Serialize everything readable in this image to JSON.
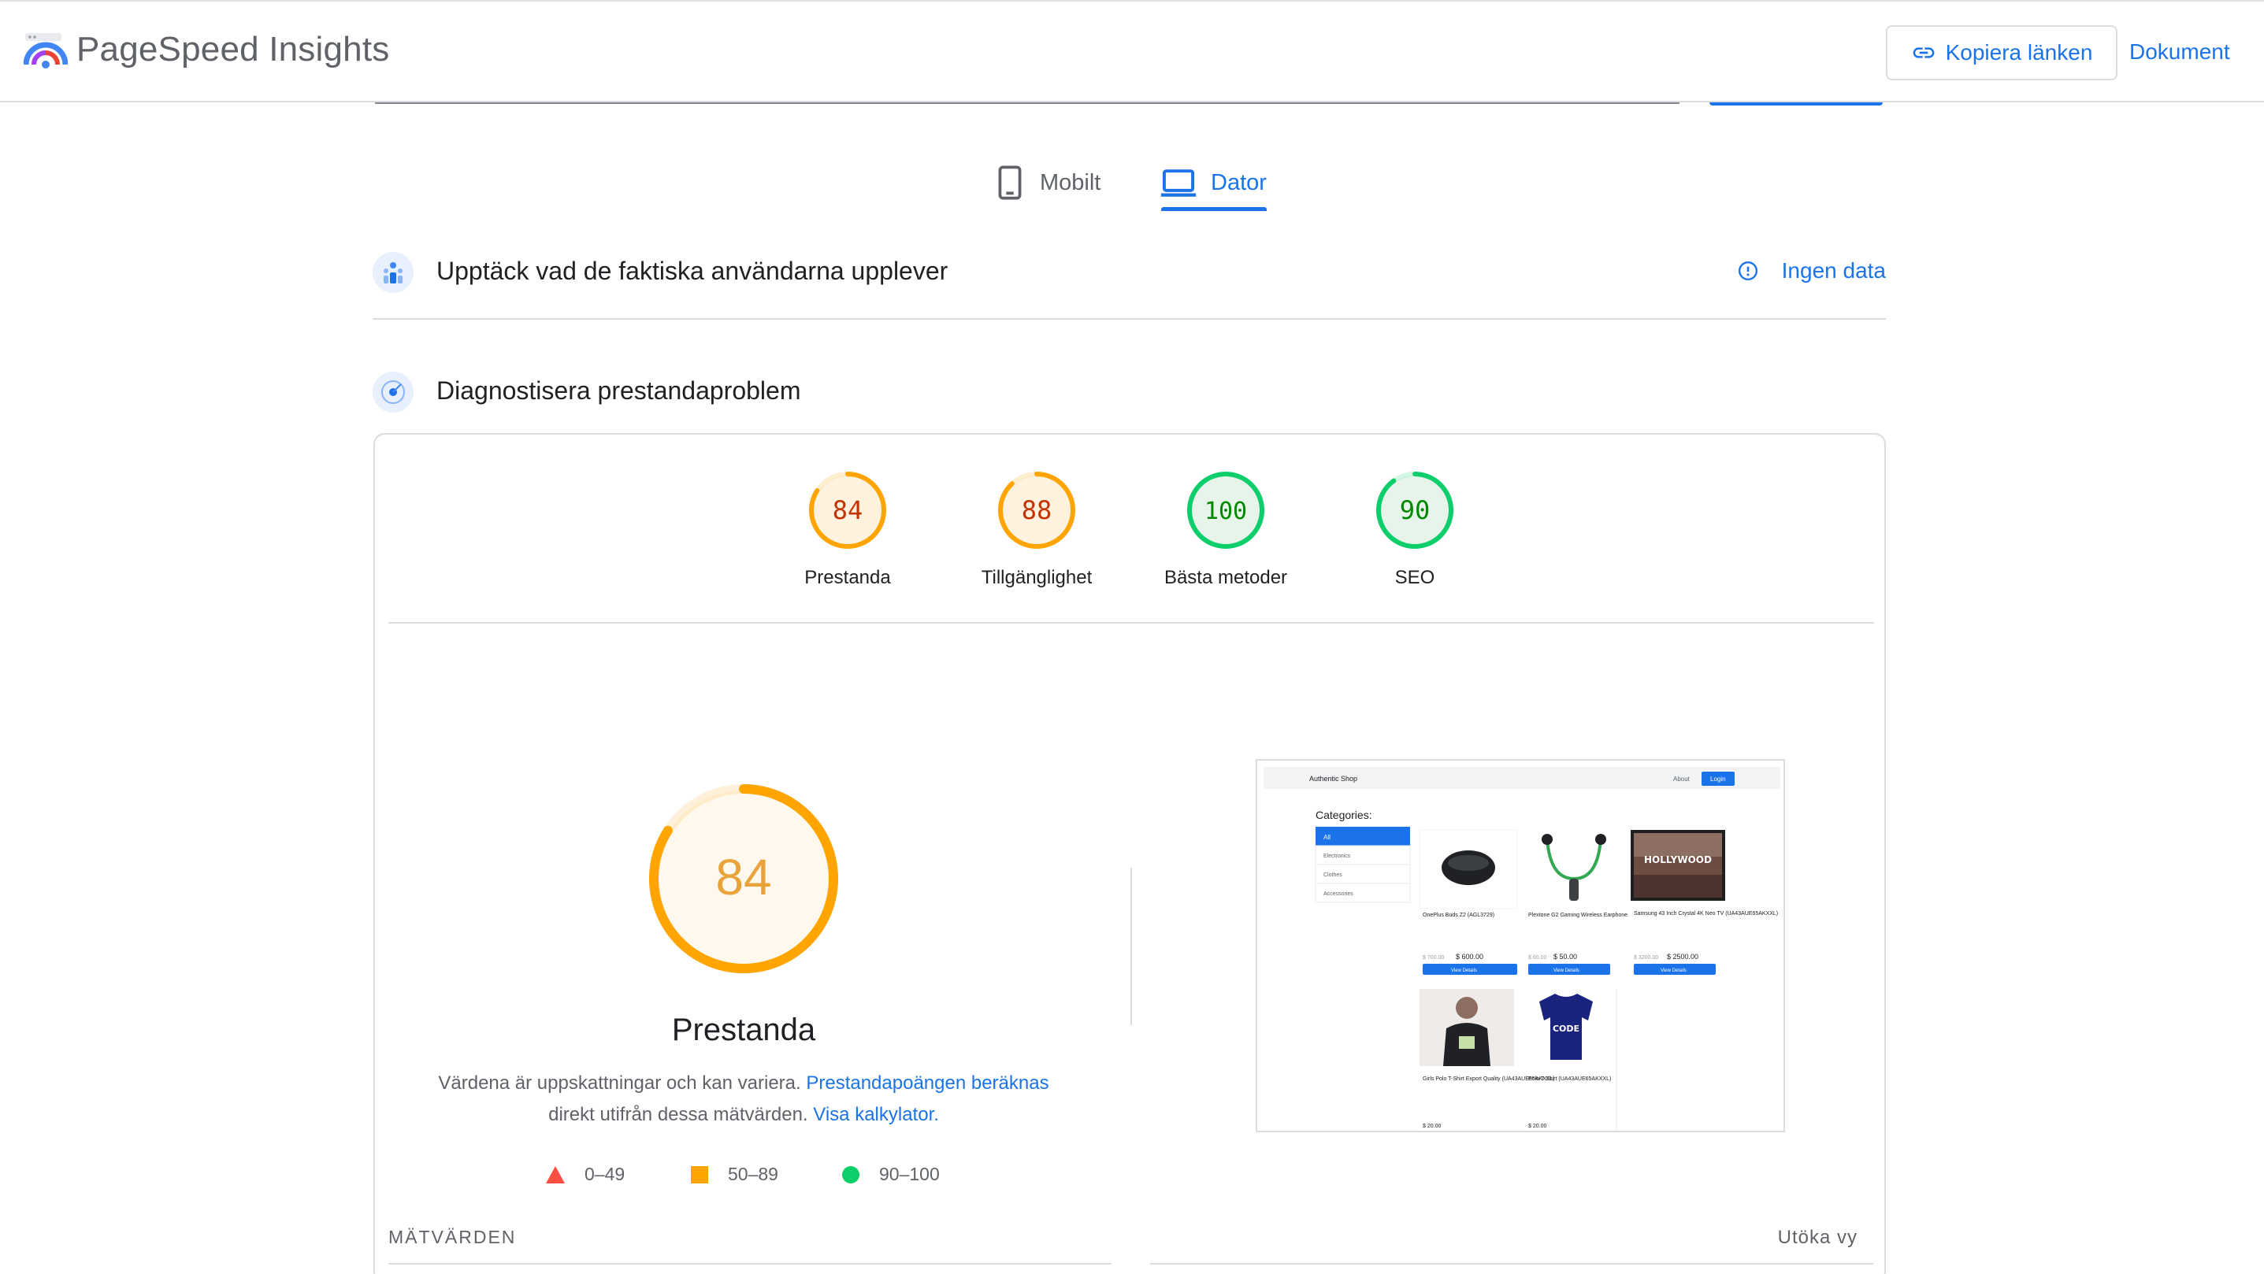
{
  "header": {
    "app_title": "PageSpeed Insights",
    "copy_link_label": "Kopiera länken",
    "docs_label": "Dokument"
  },
  "tabs": [
    {
      "label": "Mobilt",
      "icon": "smartphone-icon",
      "selected": false
    },
    {
      "label": "Dator",
      "icon": "laptop-icon",
      "selected": true
    }
  ],
  "crux": {
    "title": "Upptäck vad de faktiska användarna upplever",
    "status_label": "Ingen data"
  },
  "diagnose": {
    "title": "Diagnostisera prestandaproblem"
  },
  "scores": [
    {
      "label": "Prestanda",
      "value": "84",
      "rating": "average"
    },
    {
      "label": "Tillgänglighet",
      "value": "88",
      "rating": "average"
    },
    {
      "label": "Bästa metoder",
      "value": "100",
      "rating": "pass"
    },
    {
      "label": "SEO",
      "value": "90",
      "rating": "pass"
    }
  ],
  "performance": {
    "score": "84",
    "title": "Prestanda",
    "desc_text_1": "Värdena är uppskattningar och kan variera.",
    "desc_link_1": "Prestandapoängen beräknas",
    "desc_text_2": "direkt utifrån dessa mätvärden.",
    "desc_link_2": "Visa kalkylator."
  },
  "legend": [
    {
      "label": "0–49",
      "shape": "triangle",
      "color": "#ff4e42"
    },
    {
      "label": "50–89",
      "shape": "square",
      "color": "#ffa400"
    },
    {
      "label": "90–100",
      "shape": "circle",
      "color": "#0cce6b"
    }
  ],
  "metrics": {
    "label": "MÄTVÄRDEN",
    "expand_label": "Utöka vy"
  },
  "screenshot": {
    "brand": "Authentic Shop",
    "about": "About",
    "login": "Login",
    "categories_title": "Categories:",
    "categories": [
      "All",
      "Electronics",
      "Clothes",
      "Accessories"
    ],
    "products": [
      {
        "name": "OnePlus Buds Z2 (AGL3729)",
        "old_price": "$ 700.00",
        "price": "$ 600.00",
        "button": "View Details"
      },
      {
        "name": "Plextone G2 Gaming Wireless Earphone",
        "old_price": "$ 60.00",
        "price": "$ 50.00",
        "button": "View Details"
      },
      {
        "name": "Samsung 43 Inch Crystal 4K Neo TV (UA43AUE65AKXXL)",
        "old_price": "$ 3200.00",
        "price": "$ 2500.00",
        "button": "View Details"
      },
      {
        "name": "Girls Polo T-Shirt Export Quality (UA43AUE65AKXXL)",
        "old_price": "",
        "price": "$ 20.00",
        "button": ""
      },
      {
        "name": "Polo T-Shirt (UA43AUE65AKXXL)",
        "old_price": "",
        "price": "$ 20.00",
        "button": ""
      }
    ],
    "tv_text": "HOLLYWOOD",
    "shirt_text": "CODE"
  },
  "colors": {
    "accent": "#1a73e8",
    "average": "#ffa400",
    "average_text": "#c33300",
    "pass": "#0cce6b",
    "pass_text": "#008800"
  }
}
